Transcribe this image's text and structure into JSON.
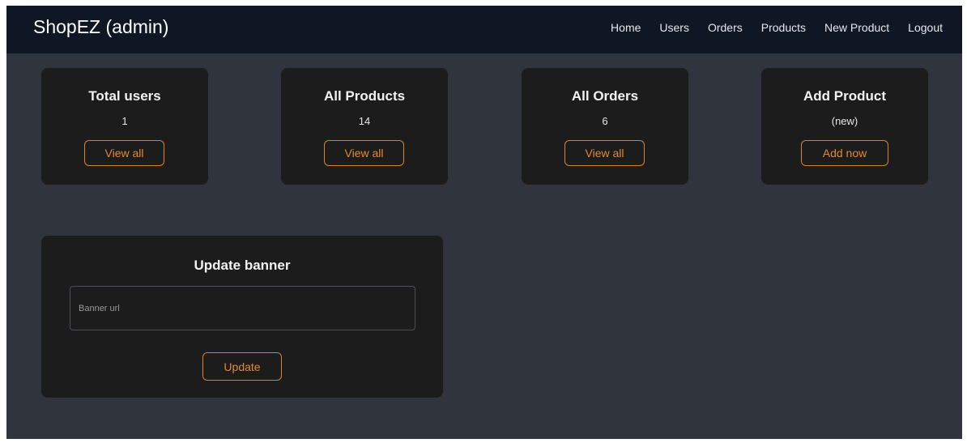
{
  "navbar": {
    "brand": "ShopEZ (admin)",
    "links": [
      "Home",
      "Users",
      "Orders",
      "Products",
      "New Product",
      "Logout"
    ]
  },
  "stats": [
    {
      "title": "Total users",
      "value": "1",
      "button": "View all"
    },
    {
      "title": "All Products",
      "value": "14",
      "button": "View all"
    },
    {
      "title": "All Orders",
      "value": "6",
      "button": "View all"
    },
    {
      "title": "Add Product",
      "value": "(new)",
      "button": "Add now"
    }
  ],
  "banner": {
    "title": "Update banner",
    "input_placeholder": "Banner url",
    "input_value": "",
    "button": "Update"
  },
  "colors": {
    "navbar_bg": "#0f1624",
    "page_bg": "#2f343d",
    "card_bg": "#1c1c1c",
    "accent": "#d9822b"
  }
}
